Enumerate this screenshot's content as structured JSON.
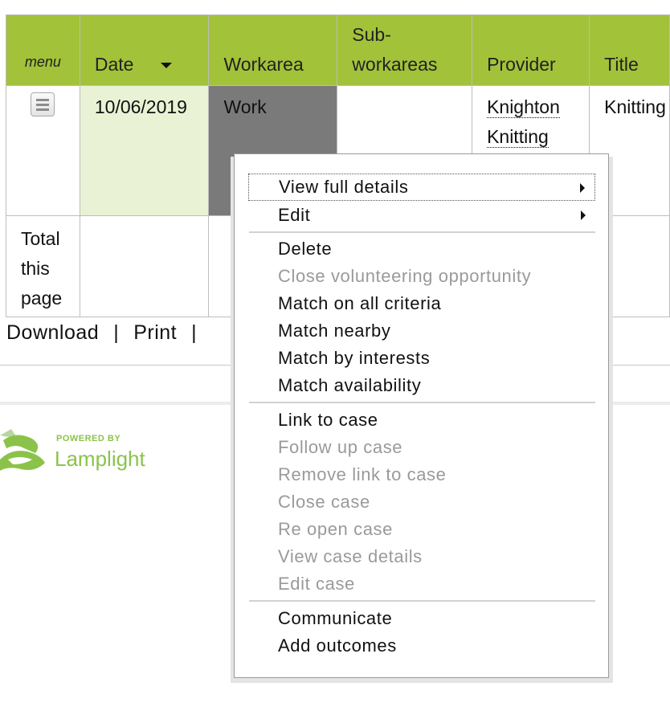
{
  "table": {
    "headers": {
      "menu": "menu",
      "date": "Date",
      "workarea": "Workarea",
      "subworkareas_line1": "Sub-",
      "subworkareas_line2": "workareas",
      "provider": "Provider",
      "title": "Title"
    },
    "row": {
      "date": "10/06/2019",
      "workarea": "Work",
      "subworkareas": "",
      "provider_line1": "Knighton",
      "provider_line2": "Knitting",
      "title": "Knitting"
    },
    "total": {
      "line1": "Total",
      "line2": "this",
      "line3": "page"
    }
  },
  "footer": {
    "download": "Download",
    "print": "Print",
    "separator": "|"
  },
  "logo": {
    "small": "POWERED BY",
    "big": "Lamplight"
  },
  "context_menu": {
    "view_full_details": "View full details",
    "edit": "Edit",
    "delete": "Delete",
    "close_volunteering": "Close volunteering opportunity",
    "match_all": "Match on all criteria",
    "match_nearby": "Match nearby",
    "match_interests": "Match by interests",
    "match_availability": "Match availability",
    "link_to_case": "Link to case",
    "follow_up_case": "Follow up case",
    "remove_link": "Remove link to case",
    "close_case": "Close case",
    "reopen_case": "Re open case",
    "view_case_details": "View case details",
    "edit_case": "Edit case",
    "communicate": "Communicate",
    "add_outcomes": "Add outcomes"
  },
  "colors": {
    "header_green": "#a2c23a",
    "date_cell": "#e9f2d4",
    "workarea_cell": "#7a7a7a",
    "disabled_text": "#9a9a9a",
    "logo_green": "#8bc34a"
  }
}
